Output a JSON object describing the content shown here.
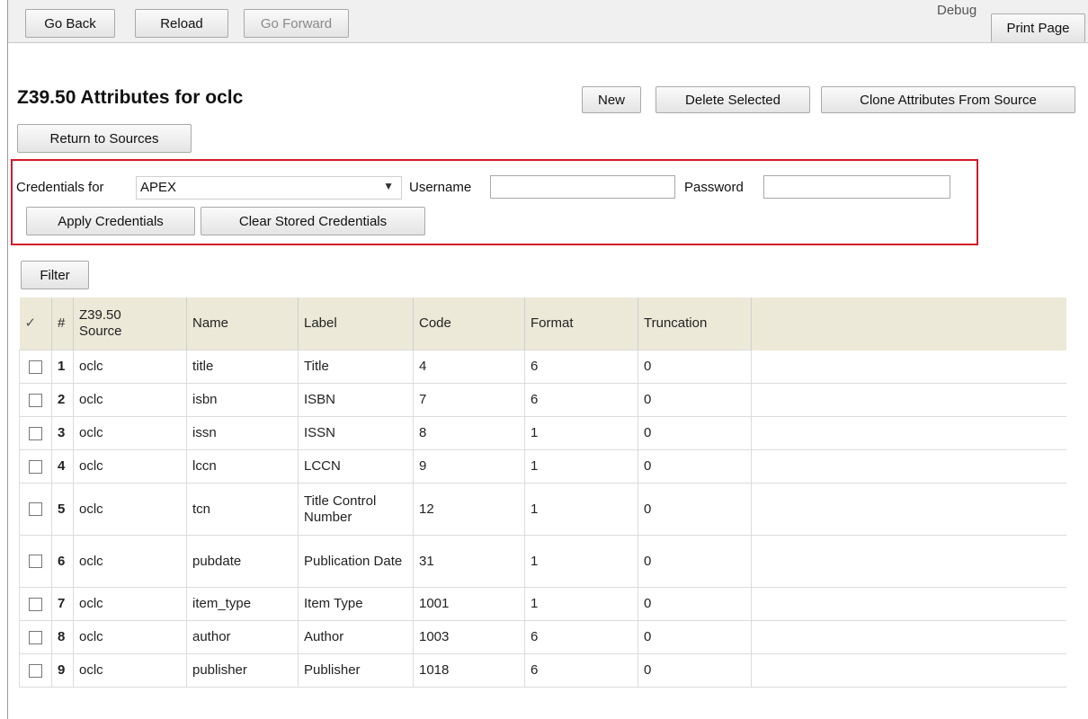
{
  "toolbar": {
    "go_back": "Go Back",
    "reload": "Reload",
    "go_forward": "Go Forward",
    "debug": "Debug",
    "print_page": "Print Page"
  },
  "page": {
    "title": "Z39.50 Attributes for oclc",
    "return_button": "Return to Sources",
    "new_button": "New",
    "delete_button": "Delete Selected",
    "clone_button": "Clone Attributes From Source"
  },
  "credentials": {
    "label": "Credentials for",
    "selected_source": "APEX",
    "username_label": "Username",
    "username_value": "",
    "password_label": "Password",
    "password_value": "",
    "apply_button": "Apply Credentials",
    "clear_button": "Clear Stored Credentials"
  },
  "filter_button": "Filter",
  "grid": {
    "columns": {
      "check": "✓",
      "num": "#",
      "source_line1": "Z39.50",
      "source_line2": "Source",
      "name": "Name",
      "label": "Label",
      "code": "Code",
      "format": "Format",
      "truncation": "Truncation"
    },
    "rows": [
      {
        "num": "1",
        "source": "oclc",
        "name": "title",
        "label": "Title",
        "code": "4",
        "format": "6",
        "truncation": "0"
      },
      {
        "num": "2",
        "source": "oclc",
        "name": "isbn",
        "label": "ISBN",
        "code": "7",
        "format": "6",
        "truncation": "0"
      },
      {
        "num": "3",
        "source": "oclc",
        "name": "issn",
        "label": "ISSN",
        "code": "8",
        "format": "1",
        "truncation": "0"
      },
      {
        "num": "4",
        "source": "oclc",
        "name": "lccn",
        "label": "LCCN",
        "code": "9",
        "format": "1",
        "truncation": "0"
      },
      {
        "num": "5",
        "source": "oclc",
        "name": "tcn",
        "label": "Title Control Number",
        "code": "12",
        "format": "1",
        "truncation": "0"
      },
      {
        "num": "6",
        "source": "oclc",
        "name": "pubdate",
        "label": "Publication Date",
        "code": "31",
        "format": "1",
        "truncation": "0"
      },
      {
        "num": "7",
        "source": "oclc",
        "name": "item_type",
        "label": "Item Type",
        "code": "1001",
        "format": "1",
        "truncation": "0"
      },
      {
        "num": "8",
        "source": "oclc",
        "name": "author",
        "label": "Author",
        "code": "1003",
        "format": "6",
        "truncation": "0"
      },
      {
        "num": "9",
        "source": "oclc",
        "name": "publisher",
        "label": "Publisher",
        "code": "1018",
        "format": "6",
        "truncation": "0"
      }
    ]
  },
  "colors": {
    "highlight_border": "#d11a2a",
    "grid_header_bg": "#ece9d8"
  },
  "icons": {
    "dropdown": "chevron-down-icon",
    "checkbox": "checkbox-icon"
  }
}
